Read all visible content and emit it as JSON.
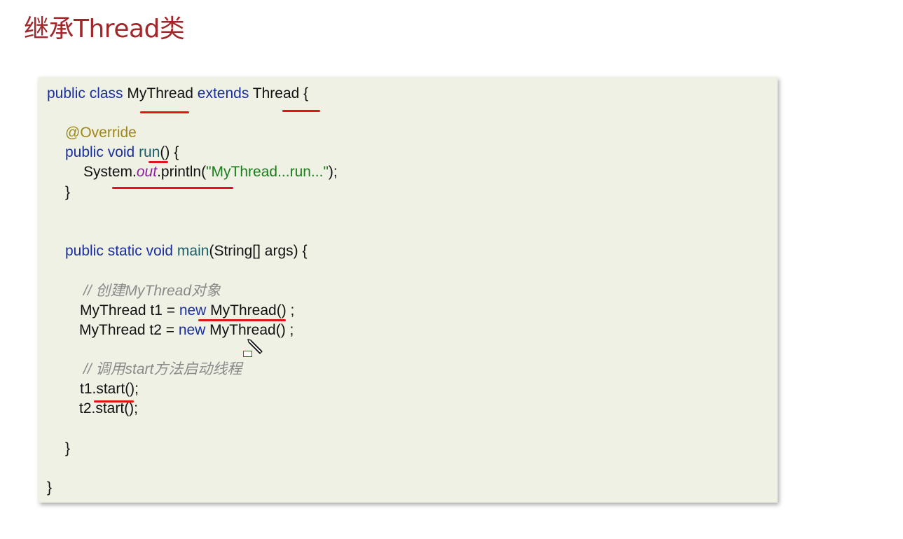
{
  "slide": {
    "title": "继承Thread类"
  },
  "code": {
    "l1": {
      "kw1": "public class ",
      "name": "MyThread ",
      "kw2": "extends ",
      "parent": "Thread",
      "tail": " {"
    },
    "l2": {
      "ann": "@Override"
    },
    "l3": {
      "kw": "public void ",
      "method": "run",
      "tail": "() {"
    },
    "l4": {
      "pre": "System.",
      "field": "out",
      "mid": ".println(",
      "str": "\"MyThread...run...\"",
      "tail": ");"
    },
    "l5": {
      "text": "}"
    },
    "l6": {
      "kw": "public static void ",
      "method": "main",
      "tail": "(String[] args) {"
    },
    "l7": {
      "comment": "// 创建MyThread对象"
    },
    "l8": {
      "pre": "MyThread t1 = ",
      "kw": "new",
      "tail": " MyThread() ;"
    },
    "l9": {
      "pre": "MyThread t2 = ",
      "kw": "new",
      "tail": " MyThread() ;"
    },
    "l10": {
      "comment": "// 调用start方法启动线程"
    },
    "l11": {
      "text": "t1.start();"
    },
    "l12": {
      "text": "t2.start();"
    },
    "l13": {
      "text": "}"
    },
    "l14": {
      "text": "}"
    }
  },
  "colors": {
    "title": "#a0282a",
    "keyword": "#1a2fa0",
    "annotation": "#a08818",
    "method": "#17606a",
    "field": "#8a1fa0",
    "string": "#1b7d1b",
    "comment": "#8a8a8a",
    "underline": "#e01616",
    "code_background": "#eef1e3"
  },
  "icons": {
    "cursor": "pencil-cursor-icon"
  }
}
